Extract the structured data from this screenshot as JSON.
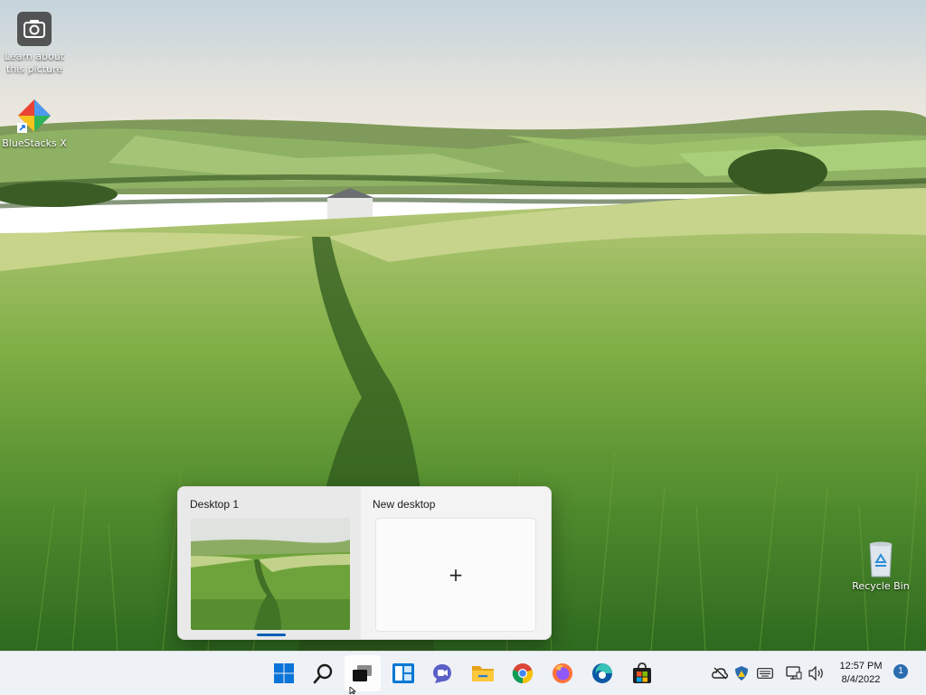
{
  "desktop": {
    "icons": [
      {
        "label": "Learn about this picture"
      },
      {
        "label": "BlueStacks X"
      },
      {
        "label": "Recycle Bin"
      }
    ]
  },
  "task_view": {
    "desktops": [
      {
        "label": "Desktop 1"
      },
      {
        "label": "New desktop",
        "tile_glyph": "+"
      }
    ]
  },
  "taskbar": {
    "apps": [
      {
        "name": "start-icon"
      },
      {
        "name": "search-icon"
      },
      {
        "name": "task-view-icon"
      },
      {
        "name": "widgets-icon"
      },
      {
        "name": "chat-icon"
      },
      {
        "name": "file-explorer-icon"
      },
      {
        "name": "chrome-icon"
      },
      {
        "name": "firefox-icon"
      },
      {
        "name": "edge-icon"
      },
      {
        "name": "store-icon"
      }
    ],
    "clock": {
      "time": "12:57 PM",
      "date": "8/4/2022"
    },
    "notification_count": "1"
  },
  "colors": {
    "accent": "#005fb8",
    "taskbar_bg": "#eef1f5",
    "flyout_bg": "#f3f3f3"
  }
}
